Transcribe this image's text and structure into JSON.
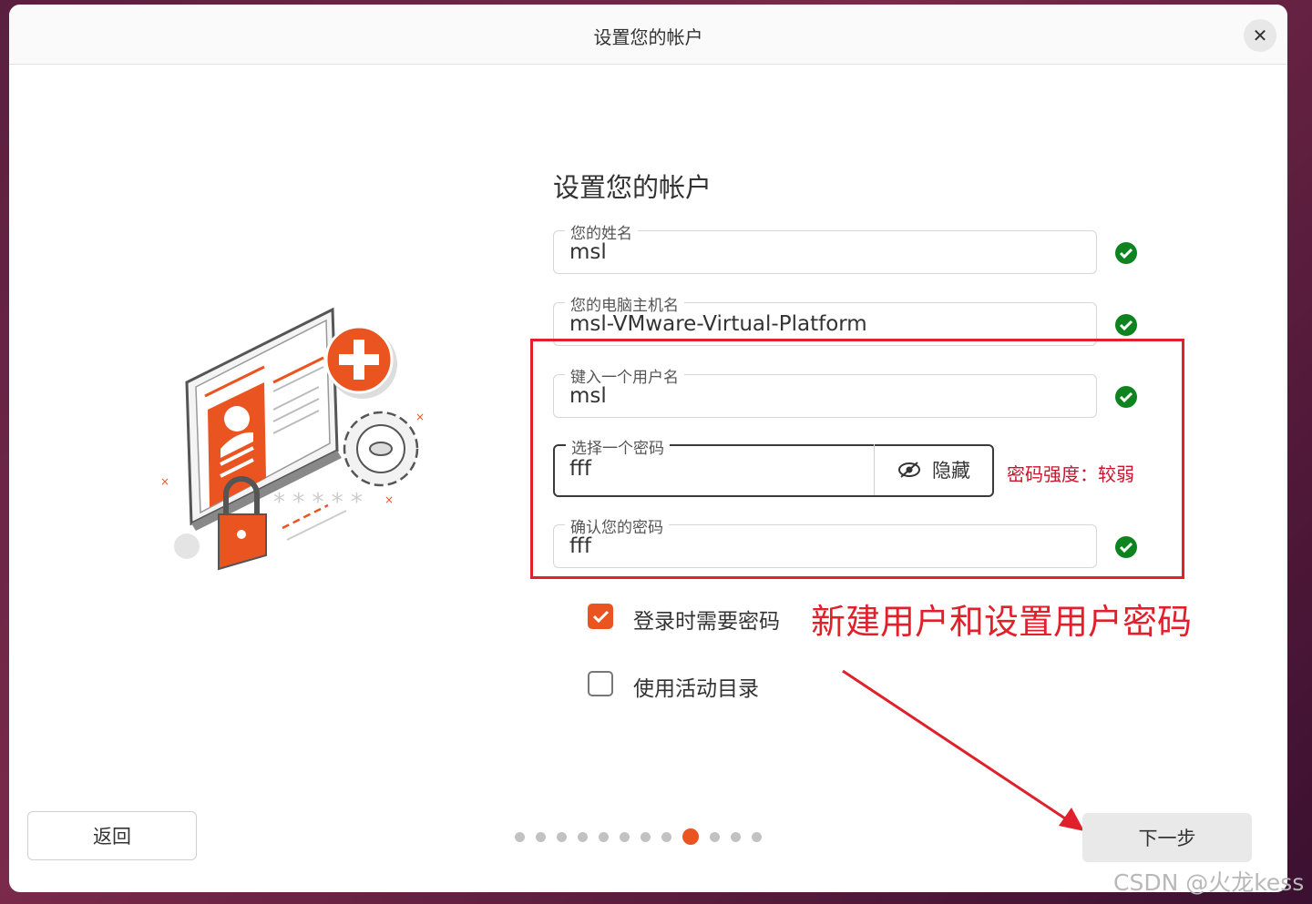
{
  "window": {
    "title": "设置您的帐户",
    "close_label": "✕"
  },
  "heading": "设置您的帐户",
  "fields": {
    "name": {
      "label": "您的姓名",
      "value": "msl"
    },
    "hostname": {
      "label": "您的电脑主机名",
      "value": "msl-VMware-Virtual-Platform"
    },
    "username": {
      "label": "键入一个用户名",
      "value": "msl"
    },
    "password": {
      "label": "选择一个密码",
      "value": "fff",
      "toggle_label": "隐藏",
      "strength": "密码强度：较弱"
    },
    "confirm": {
      "label": "确认您的密码",
      "value": "fff"
    }
  },
  "options": {
    "require_password": {
      "label": "登录时需要密码",
      "checked": true
    },
    "active_directory": {
      "label": "使用活动目录",
      "checked": false
    }
  },
  "annotation": "新建用户和设置用户密码",
  "nav": {
    "back": "返回",
    "next": "下一步",
    "total_steps": 12,
    "current_step": 9
  },
  "colors": {
    "accent": "#e95420",
    "success": "#0e8420",
    "error": "#c7162b",
    "annotation": "#e0202a"
  },
  "watermark": "CSDN @火龙kess"
}
